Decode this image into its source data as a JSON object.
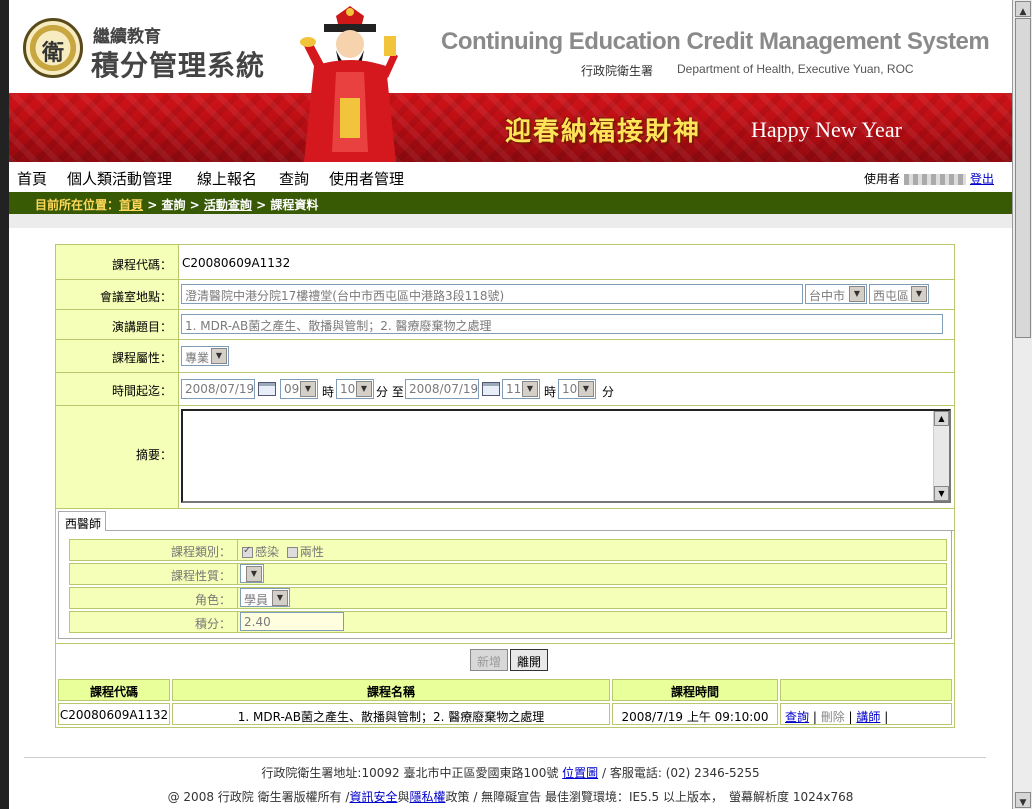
{
  "header": {
    "logo_small": "繼續教育",
    "logo_big": "積分管理系統",
    "title_en": "Continuing Education Credit Management System",
    "agency_zh": "行政院衛生署",
    "agency_en": "Department of Health, Executive Yuan, ROC"
  },
  "banner": {
    "text_zh": "迎春納福接財神",
    "text_en": "Happy New Year"
  },
  "nav": {
    "items": [
      "首頁",
      "個人類活動管理",
      "線上報名",
      "查詢",
      "使用者管理"
    ],
    "user_label": "使用者",
    "logout": "登出"
  },
  "breadcrumb": {
    "prefix": "目前所在位置：",
    "home": "首頁",
    "sep1": " > ",
    "query": "查詢",
    "sep2": " > ",
    "activity": "活動查詢",
    "sep3": " > ",
    "current": "課程資料"
  },
  "form": {
    "code_label": "課程代碼：",
    "code_value": "C20080609A1132",
    "place_label": "會議室地點：",
    "place_value": "澄清醫院中港分院17樓禮堂(台中市西屯區中港路3段118號)",
    "city": "台中市",
    "district": "西屯區",
    "topic_label": "演講題目：",
    "topic_value": "1. MDR-AB菌之產生、散播與管制；2. 醫療廢棄物之處理",
    "attr_label": "課程屬性：",
    "attr_value": "專業",
    "time_label": "時間起迄：",
    "start_date": "2008/07/19",
    "start_hour": "09",
    "hour_unit": "時",
    "start_min": "10",
    "min_unit_to": "分 至",
    "end_date": "2008/07/19",
    "end_hour": "11",
    "end_min": "10",
    "min_unit": "分",
    "summary_label": "摘要："
  },
  "tab": {
    "name": "西醫師",
    "category_label": "課程類別：",
    "cat1": "感染",
    "cat2": "兩性",
    "nature_label": "課程性質：",
    "role_label": "角色：",
    "role_value": "學員",
    "credit_label": "積分：",
    "credit_value": "2.40"
  },
  "buttons": {
    "add": "新增",
    "leave": "離開"
  },
  "table": {
    "headers": [
      "課程代碼",
      "課程名稱",
      "課程時間",
      ""
    ],
    "row": {
      "code": "C20080609A1132",
      "name": "1. MDR-AB菌之產生、散播與管制；2. 醫療廢棄物之處理",
      "time": "2008/7/19 上午 09:10:00",
      "query": "查詢",
      "delete": "刪除",
      "lecturer": "講師"
    }
  },
  "footer": {
    "addr": "行政院衛生署地址:10092 臺北市中正區愛國東路100號",
    "map": "位置圖",
    "phone": "/ 客服電話: (02) 2346-5255",
    "copy1": "@ 2008 行政院 衛生署版權所有 /",
    "security": "資訊安全",
    "and": "與",
    "privacy": "隱私權",
    "copy2": "政策 / 無障礙宣告 最佳瀏覽環境：IE5.5 以上版本，　螢幕解析度 1024x768"
  },
  "colors": {
    "nav_green": "#385a05",
    "label_yellow": "#f6ffb8",
    "banner_red": "#c8101a"
  }
}
